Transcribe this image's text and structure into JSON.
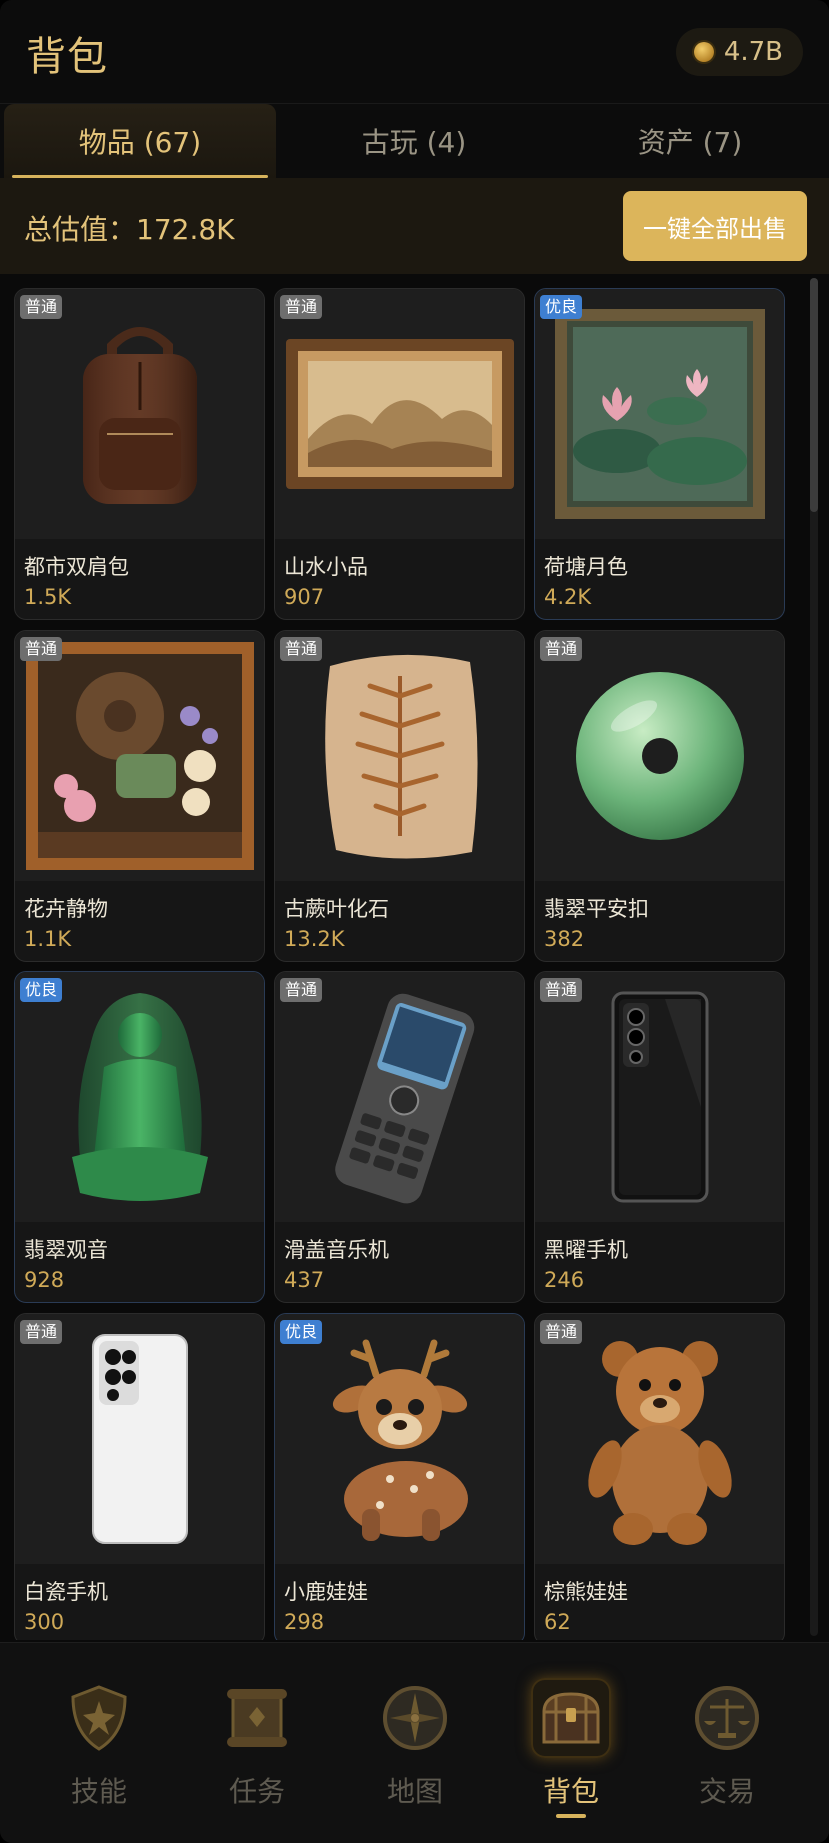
{
  "header": {
    "title": "背包",
    "coins": "4.7B"
  },
  "tabs": [
    {
      "label": "物品 (67)"
    },
    {
      "label": "古玩 (4)"
    },
    {
      "label": "资产 (7)"
    }
  ],
  "summary": {
    "total_text": "总估值：172.8K",
    "sell_all_label": "一键全部出售"
  },
  "items": [
    {
      "badge": "普通",
      "name": "都市双肩包",
      "value": "1.5K",
      "icon": "backpack-icon"
    },
    {
      "badge": "普通",
      "name": "山水小品",
      "value": "907",
      "icon": "landscape-painting-icon"
    },
    {
      "badge": "优良",
      "name": "荷塘月色",
      "value": "4.2K",
      "icon": "lotus-painting-icon"
    },
    {
      "badge": "普通",
      "name": "花卉静物",
      "value": "1.1K",
      "icon": "flower-painting-icon"
    },
    {
      "badge": "普通",
      "name": "古蕨叶化石",
      "value": "13.2K",
      "icon": "fern-fossil-icon"
    },
    {
      "badge": "普通",
      "name": "翡翠平安扣",
      "value": "382",
      "icon": "jade-disc-icon"
    },
    {
      "badge": "优良",
      "name": "翡翠观音",
      "value": "928",
      "icon": "jade-guanyin-icon"
    },
    {
      "badge": "普通",
      "name": "滑盖音乐机",
      "value": "437",
      "icon": "slider-phone-icon"
    },
    {
      "badge": "普通",
      "name": "黑曜手机",
      "value": "246",
      "icon": "black-phone-icon"
    },
    {
      "badge": "普通",
      "name": "白瓷手机",
      "value": "300",
      "icon": "white-phone-icon"
    },
    {
      "badge": "优良",
      "name": "小鹿娃娃",
      "value": "298",
      "icon": "deer-plush-icon"
    },
    {
      "badge": "普通",
      "name": "棕熊娃娃",
      "value": "62",
      "icon": "bear-plush-icon"
    }
  ],
  "nav": [
    {
      "label": "技能",
      "icon": "shield-icon"
    },
    {
      "label": "任务",
      "icon": "scroll-icon"
    },
    {
      "label": "地图",
      "icon": "compass-icon"
    },
    {
      "label": "背包",
      "icon": "treasure-chest-icon"
    },
    {
      "label": "交易",
      "icon": "scales-icon"
    }
  ],
  "colors": {
    "accent": "#e3c37a",
    "gold_button": "#dcb55b",
    "badge_normal": "#6e6e6e",
    "badge_good": "#3e7fd1"
  }
}
